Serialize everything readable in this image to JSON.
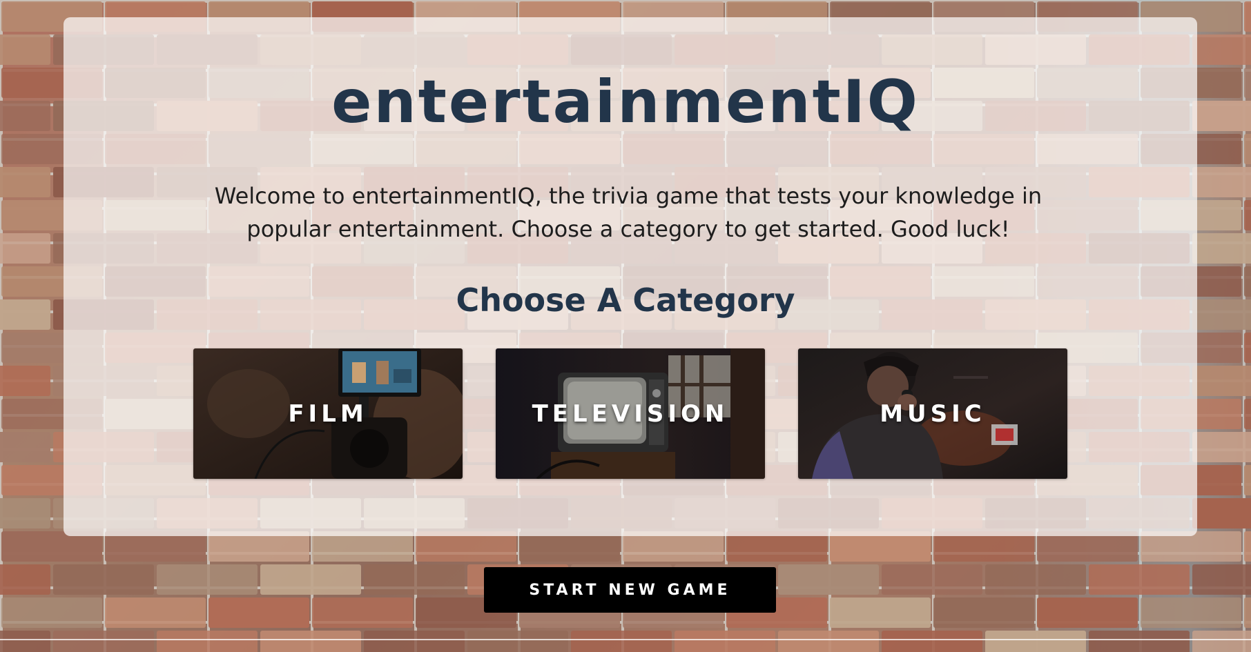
{
  "app": {
    "title": "entertainmentIQ",
    "intro": "Welcome to entertainmentIQ, the trivia game that tests your knowledge in popular entertainment. Choose a category to get started. Good luck!"
  },
  "categories": {
    "heading": "Choose A Category",
    "items": [
      {
        "label": "FILM",
        "icon": "camera-monitor-photo"
      },
      {
        "label": "TELEVISION",
        "icon": "retro-tv-photo"
      },
      {
        "label": "MUSIC",
        "icon": "singer-microphone-photo"
      }
    ]
  },
  "actions": {
    "start_label": "START NEW GAME"
  },
  "colors": {
    "heading": "#22354a",
    "button_bg": "#000000",
    "button_text": "#ffffff"
  }
}
